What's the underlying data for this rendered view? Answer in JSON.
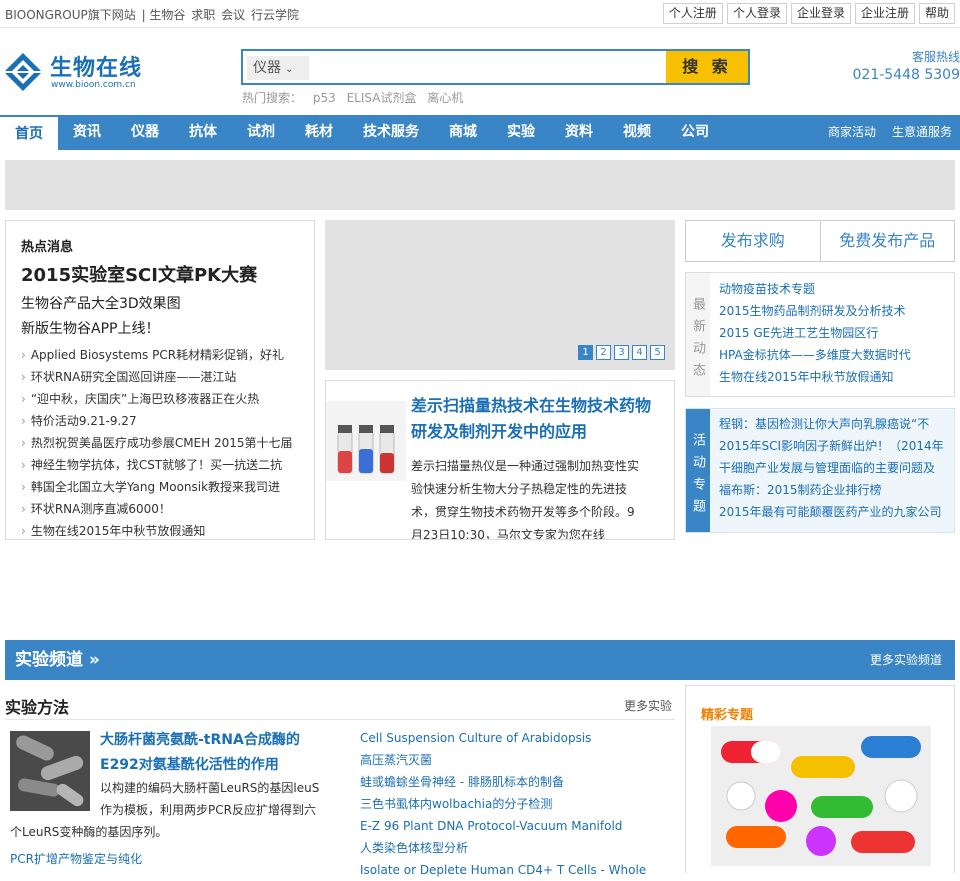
{
  "topbar": {
    "site_group": "BIOONGROUP旗下网站",
    "links": [
      "生物谷",
      "求职",
      "会议",
      "行云学院"
    ],
    "account": [
      "个人注册",
      "个人登录",
      "企业登录",
      "企业注册",
      "帮助"
    ]
  },
  "logo": {
    "name": "生物在线",
    "url": "www.bioon.com.cn"
  },
  "search": {
    "category": "仪器",
    "button": "搜 索",
    "hot_label": "热门搜索：",
    "hot_terms": [
      "p53",
      "ELISA试剂盒",
      "离心机"
    ]
  },
  "hotline": {
    "label": "客服热线",
    "number": "021-5448 5309"
  },
  "nav": {
    "items": [
      "首页",
      "资讯",
      "仪器",
      "抗体",
      "试剂",
      "耗材",
      "技术服务",
      "商城",
      "实验",
      "资料",
      "视频",
      "公司"
    ],
    "right": [
      "商家活动",
      "生意通服务"
    ]
  },
  "hotnews": {
    "heading": "热点消息",
    "headline": "2015实验室SCI文章PK大赛",
    "sub1": "生物谷产品大全3D效果图",
    "sub2": "新版生物谷APP上线！",
    "items": [
      "Applied Biosystems PCR耗材精彩促销，好礼",
      "环状RNA研究全国巡回讲座——湛江站",
      "“迎中秋，庆国庆”上海巴玖移液器正在火热",
      "特价活动9.21-9.27",
      "热烈祝贺美晶医疗成功参展CMEH 2015第十七届",
      "神经生物学抗体，找CST就够了！买一抗送二抗",
      "韩国全北国立大学Yang Moonsik教授来我司进",
      "环状RNA测序直减6000！",
      "生物在线2015年中秋节放假通知"
    ]
  },
  "slider": {
    "pages": [
      "1",
      "2",
      "3",
      "4",
      "5"
    ]
  },
  "feature": {
    "title": "差示扫描量热技术在生物技术药物研发及制剂开发中的应用",
    "desc": "差示扫描量热仪是一种通过强制加热变性实验快速分析生物大分子热稳定性的先进技术，贯穿生物技术药物开发等多个阶段。9月23日10:30，马尔文专家为您在线"
  },
  "right": {
    "tab1": "发布求购",
    "tab2": "免费发布产品",
    "latest_label": "最新动态",
    "latest": [
      "动物疫苗技术专题",
      "2015生物药品制剂研发及分析技术",
      "2015 GE先进工艺生物园区行",
      "HPA金标抗体——多维度大数据时代",
      "生物在线2015年中秋节放假通知"
    ],
    "topics_label": "活动专题",
    "topics": [
      "程钢：基因检测让你大声向乳腺癌说“不",
      "2015年SCI影响因子新鲜出炉！（2014年",
      "干细胞产业发展与管理面临的主要问题及",
      "福布斯：2015制药企业排行榜",
      "2015年最有可能颠覆医药产业的九家公司"
    ]
  },
  "channel": {
    "title": "实验频道 »",
    "more": "更多实验频道"
  },
  "methods": {
    "heading": "实验方法",
    "more": "更多实验",
    "title": "大肠杆菌亮氨酰-tRNA合成酶的E292对氨基酰化活性的作用",
    "desc_lines": [
      "以构建的编码大肠杆菌LeuRS的基因leuS",
      "作为模板，利用两步PCR反应扩增得到六",
      "个LeuRS变种酶的基因序列。"
    ],
    "link": "PCR扩增产物鉴定与纯化",
    "list": [
      "Cell Suspension Culture of Arabidopsis",
      "高压蒸汽灭菌",
      "蛙或蟾蜍坐骨神经 - 腓肠肌标本的制备",
      "三色书虱体内wolbachia的分子检测",
      "E-Z 96 Plant DNA Protocol-Vacuum Manifold",
      "人类染色体核型分析",
      "Isolate or Deplete Human CD4+ T Cells - Whole"
    ]
  },
  "special": {
    "title": "精彩专题"
  },
  "colors": {
    "brand_blue": "#3a85c5",
    "search_yellow": "#f7c000",
    "special_orange": "#f08000"
  }
}
